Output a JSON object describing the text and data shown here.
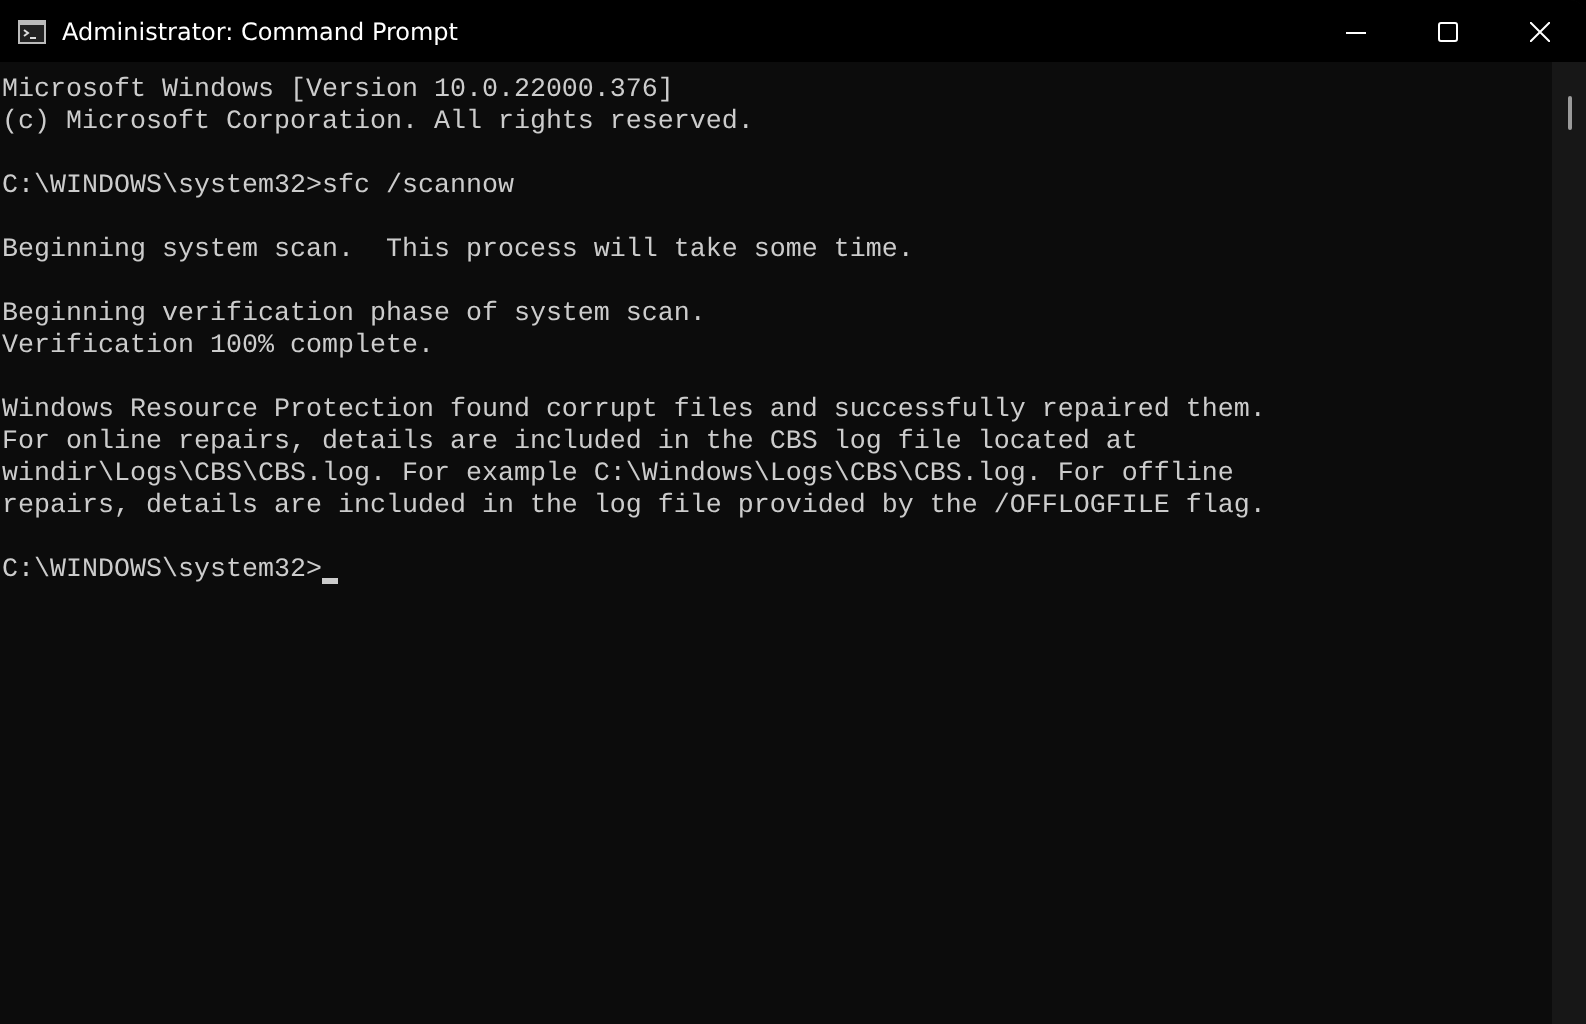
{
  "window": {
    "title": "Administrator: Command Prompt"
  },
  "console": {
    "blocks": [
      [
        "Microsoft Windows [Version 10.0.22000.376]",
        "(c) Microsoft Corporation. All rights reserved."
      ],
      [
        "C:\\WINDOWS\\system32>sfc /scannow"
      ],
      [
        "Beginning system scan.  This process will take some time."
      ],
      [
        "Beginning verification phase of system scan.",
        "Verification 100% complete."
      ],
      [
        "Windows Resource Protection found corrupt files and successfully repaired them.",
        "For online repairs, details are included in the CBS log file located at",
        "windir\\Logs\\CBS\\CBS.log. For example C:\\Windows\\Logs\\CBS\\CBS.log. For offline",
        "repairs, details are included in the log file provided by the /OFFLOGFILE flag."
      ]
    ],
    "prompt": "C:\\WINDOWS\\system32>"
  }
}
